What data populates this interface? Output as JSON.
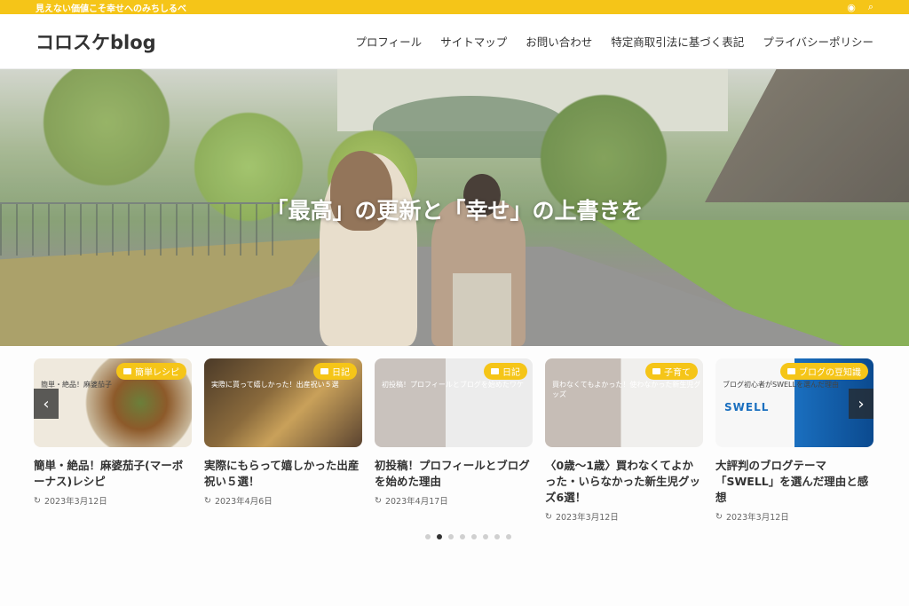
{
  "topbar": {
    "tagline": "見えない価値こそ幸せへのみちしるべ",
    "icons": [
      "rss-icon",
      "search-icon"
    ]
  },
  "header": {
    "logo": "コロスケblog",
    "nav": [
      "プロフィール",
      "サイトマップ",
      "お問い合わせ",
      "特定商取引法に基づく表記",
      "プライバシーポリシー"
    ]
  },
  "hero": {
    "catchphrase": "「最高」の更新と「幸せ」の上書きを"
  },
  "slider": {
    "posts": [
      {
        "category": "簡単レシピ",
        "title": "簡単・絶品！麻婆茄子(マーボーナス)レシピ",
        "date": "2023年3月12日",
        "thumb_text": "簡単・絶品！麻婆茄子"
      },
      {
        "category": "日記",
        "title": "実際にもらって嬉しかった出産祝い５選！",
        "date": "2023年4月6日",
        "thumb_text": "実際に貰って嬉しかった！出産祝い５選"
      },
      {
        "category": "日記",
        "title": "初投稿！プロフィールとブログを始めた理由",
        "date": "2023年4月17日",
        "thumb_text": "初投稿！プロフィールとブログを始めたワケ"
      },
      {
        "category": "子育て",
        "title": "〈0歳〜1歳〉買わなくてよかった・いらなかった新生児グッズ6選！",
        "date": "2023年3月12日",
        "thumb_text": "買わなくてもよかった！使わなかった新生児グッズ"
      },
      {
        "category": "ブログの豆知識",
        "title": "大評判のブログテーマ「SWELL」を選んだ理由と感想",
        "date": "2023年3月12日",
        "thumb_text": "ブログ初心者がSWELLを選んだ理由"
      }
    ],
    "brand_text": "SWELL",
    "dot_count": 8,
    "active_dot": 1
  },
  "colors": {
    "accent": "#f5c518"
  }
}
